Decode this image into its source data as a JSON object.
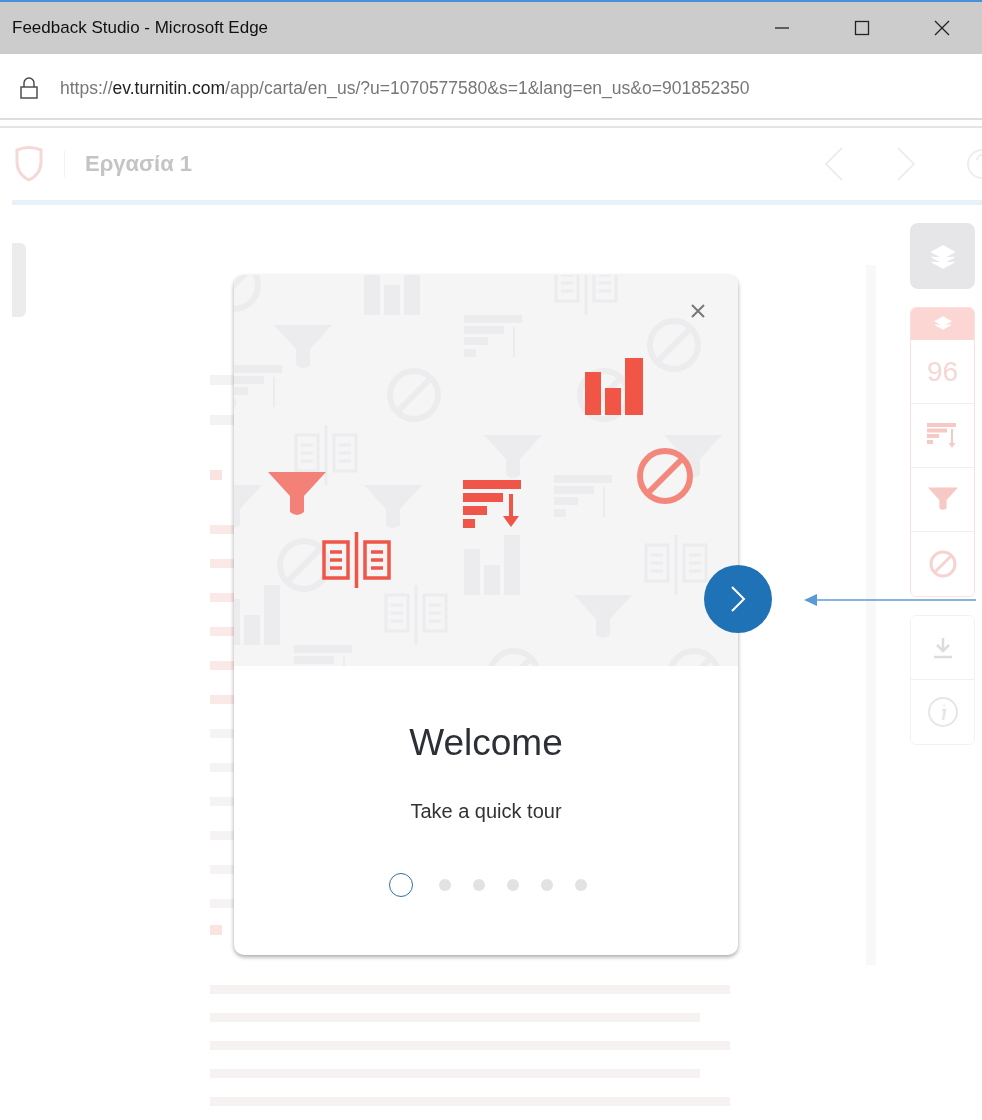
{
  "window": {
    "title": "Feedback Studio - Microsoft Edge"
  },
  "address_bar": {
    "scheme": "https://",
    "host": "ev.turnitin.com",
    "path": "/app/carta/en_us/?u=1070577580&s=1&lang=en_us&o=901852350"
  },
  "header": {
    "title": "Εργασία 1"
  },
  "side_rail": {
    "score": "96"
  },
  "tour": {
    "title": "Welcome",
    "subtitle": "Take a quick tour",
    "steps": [
      {
        "selected": true
      },
      {
        "selected": false
      },
      {
        "selected": false
      },
      {
        "selected": false
      },
      {
        "selected": false
      },
      {
        "selected": false
      }
    ]
  }
}
